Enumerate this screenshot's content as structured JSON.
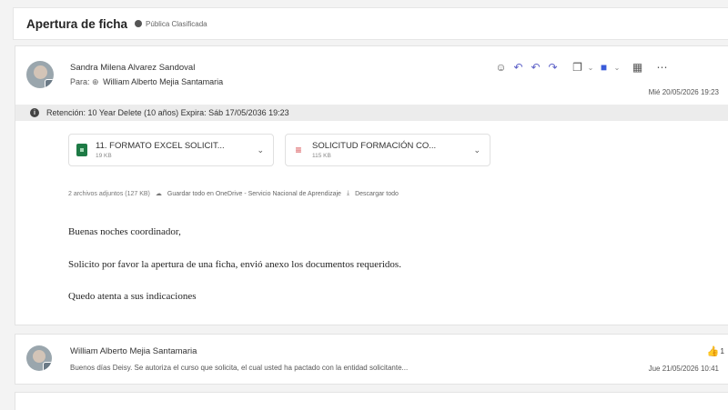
{
  "header": {
    "subject": "Apertura de ficha",
    "classification": "Pública Clasificada"
  },
  "message": {
    "sender": "Sandra Milena Alvarez Sandoval",
    "to_prefix": "Para:",
    "to_name": "William Alberto Mejia Santamaria",
    "date": "Mié 20/05/2026 19:23",
    "retention": "Retención: 10 Year Delete (10 años) Expira: Sáb 17/05/2036 19:23",
    "attachments": [
      {
        "name": "11. FORMATO EXCEL SOLICIT...",
        "size": "19 KB",
        "type": "excel"
      },
      {
        "name": "SOLICITUD FORMACIÓN CO...",
        "size": "115 KB",
        "type": "pdf"
      }
    ],
    "attachments_summary": "2 archivos adjuntos (127 KB)",
    "save_onedrive": "Guardar todo en OneDrive - Servicio Nacional de Aprendizaje",
    "download_all": "Descargar todo",
    "body": [
      "Buenas noches coordinador,",
      "Solicito por favor la apertura de una ficha, envió anexo los documentos requeridos.",
      "Quedo atenta a sus indicaciones"
    ]
  },
  "reply": {
    "sender": "William Alberto Mejia Santamaria",
    "preview": "Buenos días Deisy. Se autoriza el curso que solicita, el cual usted ha pactado con la entidad solicitante...",
    "date": "Jue 21/05/2026 10:41",
    "like_count": "1"
  },
  "colors": {
    "accent": "#5b5fc7",
    "excel": "#1d7a45",
    "pdf": "#d13438"
  }
}
